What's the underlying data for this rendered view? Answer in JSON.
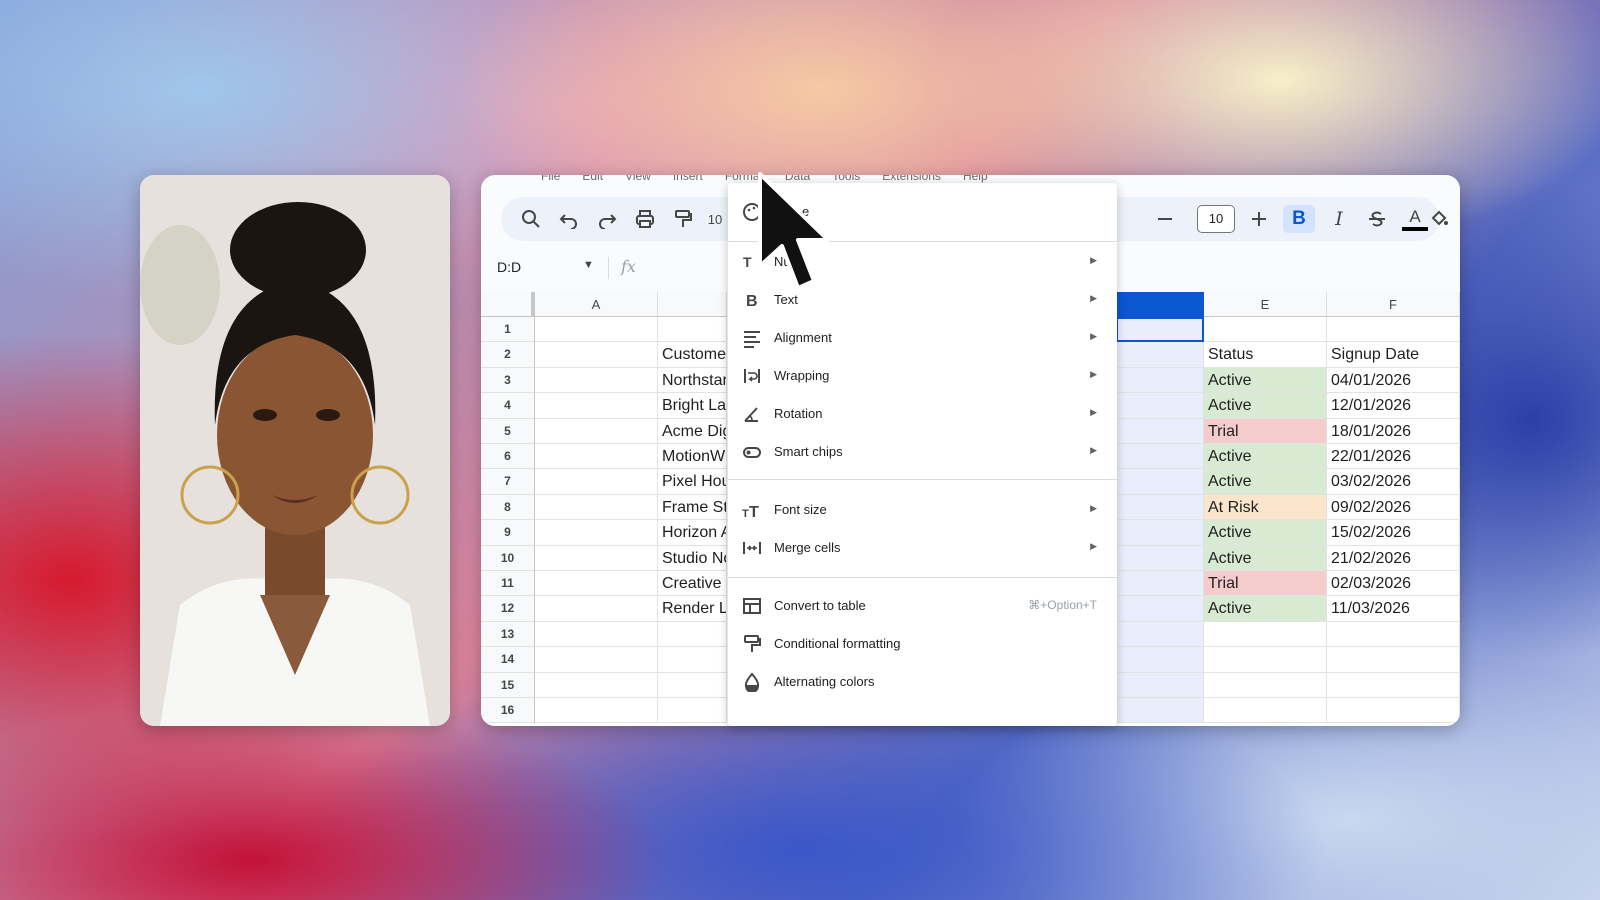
{
  "menubar": [
    "File",
    "Edit",
    "View",
    "Insert",
    "Format",
    "Data",
    "Tools",
    "Extensions",
    "Help"
  ],
  "toolbar": {
    "font_size": "10",
    "zoom_partial": "10",
    "bold_label": "B",
    "italic_label": "I",
    "text_color_label": "A"
  },
  "formula_bar": {
    "name_box": "D:D",
    "fx_label": "fx"
  },
  "grid": {
    "columns": [
      {
        "id": "A",
        "label": "A"
      },
      {
        "id": "E",
        "label": "E"
      },
      {
        "id": "F",
        "label": "F"
      }
    ],
    "rows": [
      {
        "n": "1",
        "b": "",
        "e": "",
        "f": ""
      },
      {
        "n": "2",
        "b": "Custome",
        "e": "Status",
        "f": "Signup Date"
      },
      {
        "n": "3",
        "b": "Northstar",
        "e": "Active",
        "f": "04/01/2026"
      },
      {
        "n": "4",
        "b": "Bright La",
        "e": "Active",
        "f": "12/01/2026"
      },
      {
        "n": "5",
        "b": "Acme Dig",
        "e": "Trial",
        "f": "18/01/2026"
      },
      {
        "n": "6",
        "b": "MotionW",
        "e": "Active",
        "f": "22/01/2026"
      },
      {
        "n": "7",
        "b": "Pixel Hou",
        "e": "Active",
        "f": "03/02/2026"
      },
      {
        "n": "8",
        "b": "Frame St",
        "e": "At Risk",
        "f": "09/02/2026"
      },
      {
        "n": "9",
        "b": "Horizon A",
        "e": "Active",
        "f": "15/02/2026"
      },
      {
        "n": "10",
        "b": "Studio No",
        "e": "Active",
        "f": "21/02/2026"
      },
      {
        "n": "11",
        "b": "Creative",
        "e": "Trial",
        "f": "02/03/2026"
      },
      {
        "n": "12",
        "b": "Render L",
        "e": "Active",
        "f": "11/03/2026"
      },
      {
        "n": "13",
        "b": "",
        "e": "",
        "f": ""
      },
      {
        "n": "14",
        "b": "",
        "e": "",
        "f": ""
      },
      {
        "n": "15",
        "b": "",
        "e": "",
        "f": ""
      },
      {
        "n": "16",
        "b": "",
        "e": "",
        "f": ""
      }
    ]
  },
  "format_menu": {
    "theme_partial": "e",
    "items": [
      {
        "label": "Nu",
        "icon": "number-format-icon",
        "submenu": true
      },
      {
        "label": "Text",
        "icon": "bold-icon",
        "submenu": true
      },
      {
        "label": "Alignment",
        "icon": "align-icon",
        "submenu": true
      },
      {
        "label": "Wrapping",
        "icon": "wrap-icon",
        "submenu": true
      },
      {
        "label": "Rotation",
        "icon": "rotation-icon",
        "submenu": true
      },
      {
        "label": "Smart chips",
        "icon": "smart-chip-icon",
        "submenu": true
      },
      {
        "label": "Font size",
        "icon": "font-size-icon",
        "submenu": true
      },
      {
        "label": "Merge cells",
        "icon": "merge-icon",
        "submenu": true
      },
      {
        "label": "Convert to table",
        "icon": "table-icon",
        "shortcut": "⌘+Option+T"
      },
      {
        "label": "Conditional formatting",
        "icon": "paint-roller-icon"
      },
      {
        "label": "Alternating colors",
        "icon": "fill-drop-icon"
      }
    ]
  },
  "colors": {
    "status_active": "#d9ead3",
    "status_trial": "#f4cccc",
    "status_at_risk": "#fce5cd",
    "selected_column": "#0b57d0"
  }
}
